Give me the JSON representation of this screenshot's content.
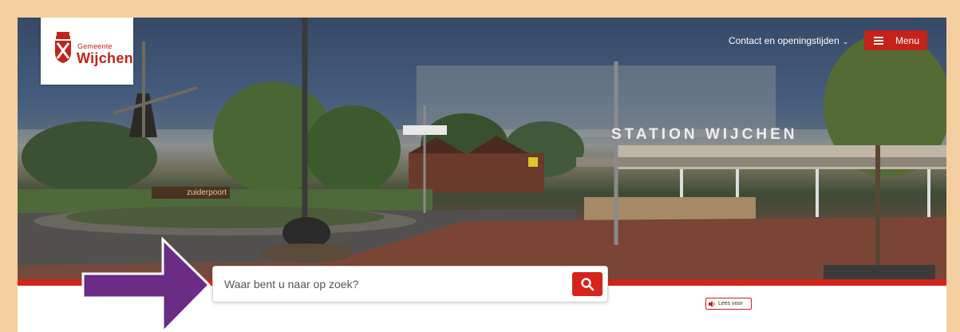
{
  "logo": {
    "small_text": "Gemeente",
    "big_text": "Wijchen"
  },
  "header": {
    "contact_link": "Contact en openingstijden",
    "menu_label": "Menu"
  },
  "hero": {
    "station_sign": "STATION WIJCHEN",
    "zuiderpoort_sign": "zuiderpoort"
  },
  "search": {
    "placeholder": "Waar bent u naar op zoek?"
  },
  "lees_voor": {
    "label": "Lees voor"
  },
  "colors": {
    "brand_red": "#c4221a",
    "frame_beige": "#f3cfa0",
    "annotation_purple": "#6a2c84"
  },
  "icons": [
    "crest-icon",
    "chevron-down-icon",
    "hamburger-icon",
    "search-icon",
    "speaker-icon",
    "annotation-arrow-icon"
  ]
}
